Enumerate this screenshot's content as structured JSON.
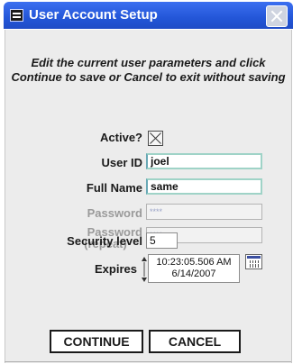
{
  "window": {
    "title": "User Account Setup",
    "icon": "app-menu-icon",
    "close_icon": "close-icon"
  },
  "instructions": "Edit the current user parameters and click Continue to save or Cancel to exit without saving",
  "form": {
    "active_label": "Active?",
    "active_checked": true,
    "user_id_label": "User ID",
    "user_id_value": "joel",
    "full_name_label": "Full Name",
    "full_name_value": "same",
    "password_label": "Password",
    "password_value": "****",
    "password_repeat_label_line1": "Password",
    "password_repeat_label_line2": "(repeat)",
    "password_repeat_value": "****",
    "security_level_label": "Security level",
    "security_level_value": "5",
    "expires_label": "Expires",
    "expires_time": "10:23:05.506 AM",
    "expires_date": "6/14/2007",
    "calendar_icon": "calendar-icon"
  },
  "buttons": {
    "continue_label": "CONTINUE",
    "cancel_label": "CANCEL"
  },
  "colors": {
    "titlebar": "#2356d8",
    "panel": "#ececec",
    "active_field_border": "#9fd3c7"
  }
}
